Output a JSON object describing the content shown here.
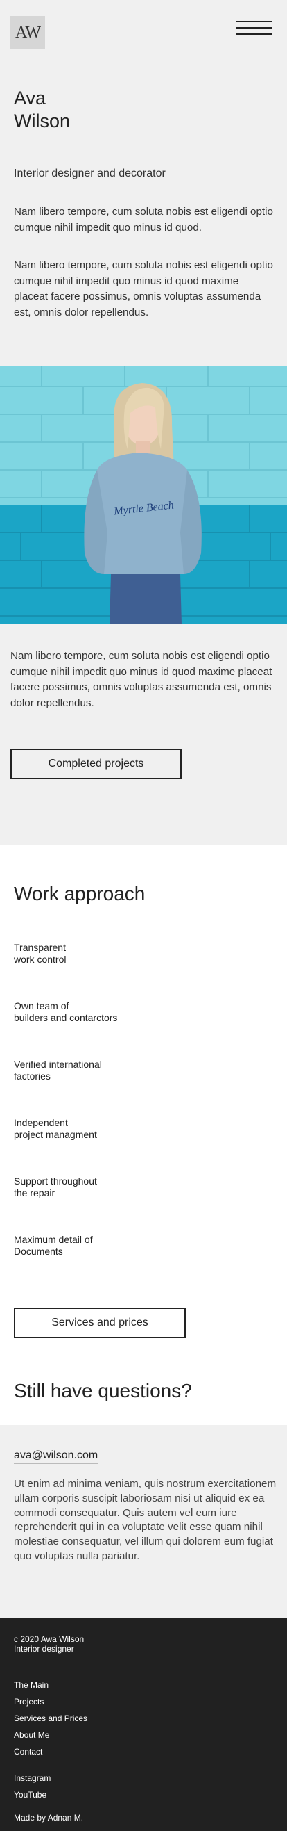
{
  "header": {
    "logo_text": "AW",
    "menu_icon": "hamburger-menu-icon"
  },
  "hero": {
    "name_line1": "Ava",
    "name_line2": "Wilson",
    "subtitle": "Interior designer and decorator",
    "paragraph1": "Nam libero tempore, cum soluta nobis est eligendi optio cumque nihil impedit quo minus id quod.",
    "paragraph2": "Nam libero tempore, cum soluta nobis est eligendi optio cumque nihil impedit quo minus id quod maxime placeat facere possimus, omnis voluptas assumenda est, omnis dolor repellendus.",
    "photo_shirt_text": "Myrtle Beach"
  },
  "about": {
    "paragraph": "Nam libero tempore, cum soluta nobis est eligendi optio cumque nihil impedit quo minus id quod maxime placeat facere possimus, omnis voluptas assumenda est, omnis dolor repellendus.",
    "button_label": "Completed projects"
  },
  "work_approach": {
    "title": "Work approach",
    "items": [
      {
        "line1": "Transparent",
        "line2": "work control"
      },
      {
        "line1": "Own team of",
        "line2": "builders and contarctors"
      },
      {
        "line1": "Verified international",
        "line2": "factories"
      },
      {
        "line1": "Independent",
        "line2": "project managment"
      },
      {
        "line1": "Support throughout",
        "line2": "the repair"
      },
      {
        "line1": "Maximum detail of",
        "line2": "Documents"
      }
    ],
    "button_label": "Services and prices"
  },
  "questions": {
    "title": "Still have questions?"
  },
  "contact": {
    "email": "ava@wilson.com",
    "text": "Ut enim ad minima veniam, quis nostrum exercitationem ullam corporis suscipit laboriosam nisi ut aliquid ex ea commodi consequatur. Quis autem vel eum iure reprehenderit qui in ea voluptate velit esse quam nihil molestiae consequatur, vel illum qui dolorem eum fugiat quo voluptas nulla pariatur."
  },
  "footer": {
    "copyright": "c 2020 Awa Wilson",
    "role": "Interior designer",
    "nav": [
      "The Main",
      "Projects",
      "Services and Prices",
      "About Me",
      "Contact"
    ],
    "social": [
      "Instagram",
      "YouTube"
    ],
    "made_by": "Made by Adnan M."
  }
}
